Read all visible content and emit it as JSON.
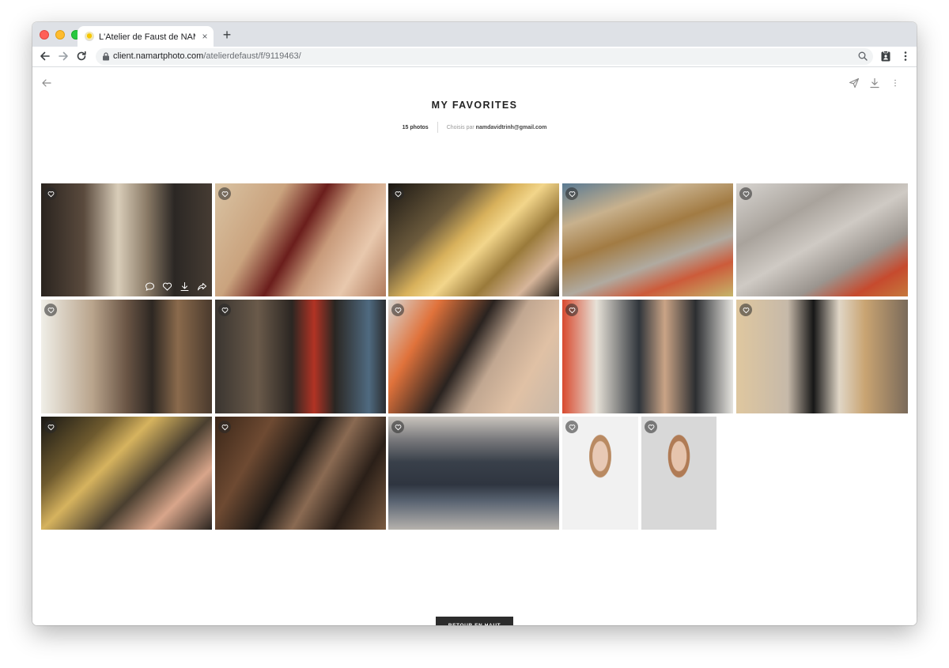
{
  "browser": {
    "tab_title": "L'Atelier de Faust de NAM.ART",
    "tab_close": "×",
    "new_tab": "+",
    "url_host": "client.namartphoto.com",
    "url_path": "/atelierdefaust/f/9119463/"
  },
  "page": {
    "title": "MY FAVORITES",
    "photo_count": "15 photos",
    "chosen_by_label": "Choisis par",
    "chosen_by_email": "namdavidtrinh@gmail.com",
    "back_to_top": "RETOUR EN HAUT"
  },
  "colors": {
    "accent_dark": "#2c2c2c",
    "tab_strip": "#dee1e6",
    "omnibox": "#f1f3f4"
  },
  "photos": [
    {
      "subject": "workshop-two-men",
      "bg": "linear-gradient(90deg,#2a241f 0%,#5a4a3d 25%,#d9cdb9 45%,#8a7a66 62%,#2b2724 78%,#463c33 100%)"
    },
    {
      "subject": "bassoon-hands",
      "bg": "linear-gradient(120deg,#d9c3a3 0%,#caa37e 30%,#6b1e1c 48%,#c89a7a 62%,#e8c8ad 80%,#b07a5c 100%)"
    },
    {
      "subject": "sax-keys-gold",
      "bg": "linear-gradient(135deg,#1b1713 0%,#6b5a3c 30%,#d8b15b 45%,#f2d58a 55%,#9a7a3a 70%,#d6b59a 85%,#2a241d 100%)"
    },
    {
      "subject": "brass-parts-table",
      "bg": "linear-gradient(160deg,#5a7a93 0%,#c8b18d 25%,#a27b43 45%,#b0aaa0 65%,#cc5b3a 80%,#c5b56a 100%)"
    },
    {
      "subject": "silver-tubes",
      "bg": "linear-gradient(150deg,#d7d4d0 0%,#a9a39c 30%,#cfcac4 50%,#9b958f 70%,#c64a2e 85%,#c6793c 100%)"
    },
    {
      "subject": "workbench-wide",
      "bg": "linear-gradient(90deg,#f0efe8 0%,#b9a48c 30%,#6a5545 50%,#2d2722 65%,#8a6a4c 80%,#4a3a2d 100%)"
    },
    {
      "subject": "man-red-part",
      "bg": "linear-gradient(90deg,#3a3530 0%,#6a5a4a 25%,#2b2622 45%,#b23324 58%,#2a2622 70%,#4f6a80 90%,#2b2d30 100%)"
    },
    {
      "subject": "clarinet-keys",
      "bg": "linear-gradient(120deg,#d8d6d2 0%,#e0723b 22%,#2a2320 45%,#c1a791 60%,#e0c1a5 78%,#c7b7a7 100%)"
    },
    {
      "subject": "repair-closeup",
      "bg": "linear-gradient(90deg,#d84a2f 0%,#e7e2d8 20%,#30353b 45%,#caa486 60%,#2c2e31 78%,#e6e4df 100%)"
    },
    {
      "subject": "flute-lamp",
      "bg": "linear-gradient(90deg,#dfc79f 0%,#c6b9a9 30%,#171717 45%,#e0d6c6 60%,#c9a472 75%,#7a6a5a 100%)"
    },
    {
      "subject": "sax-torch",
      "bg": "linear-gradient(135deg,#181714 0%,#6e5a2e 25%,#d6b35e 40%,#4a3f30 60%,#d8a58a 78%,#2a241f 100%)"
    },
    {
      "subject": "clarinet-drawer",
      "bg": "linear-gradient(120deg,#3a2618 0%,#6e4a32 25%,#1f1a16 45%,#8a6a52 60%,#2a1f18 78%,#7a5a40 100%)"
    },
    {
      "subject": "shopfront",
      "bg": "linear-gradient(180deg,#c9c4bd 0%,#7a7a7d 20%,#39404a 40%,#2f3540 60%,#5a6472 75%,#b6b2ad 100%)"
    },
    {
      "subject": "portrait-glasses",
      "bg": "radial-gradient(ellipse at 50% 35%,#e8c9b5 0 14%,#b98a62 15% 20%,#f1f1f1 21% 45%),linear-gradient(180deg,#f1f1f1 0%,#eeeeee 55%,#1f2328 70%,#1a1d22 100%)"
    },
    {
      "subject": "portrait-plain",
      "bg": "radial-gradient(ellipse at 50% 35%,#e6c4ad 0 14%,#b07b55 15% 20%,#d8d8d8 21% 45%),linear-gradient(180deg,#d8d8d8 0%,#d4d4d4 55%,#1f2328 70%,#1a1d22 100%)"
    }
  ]
}
